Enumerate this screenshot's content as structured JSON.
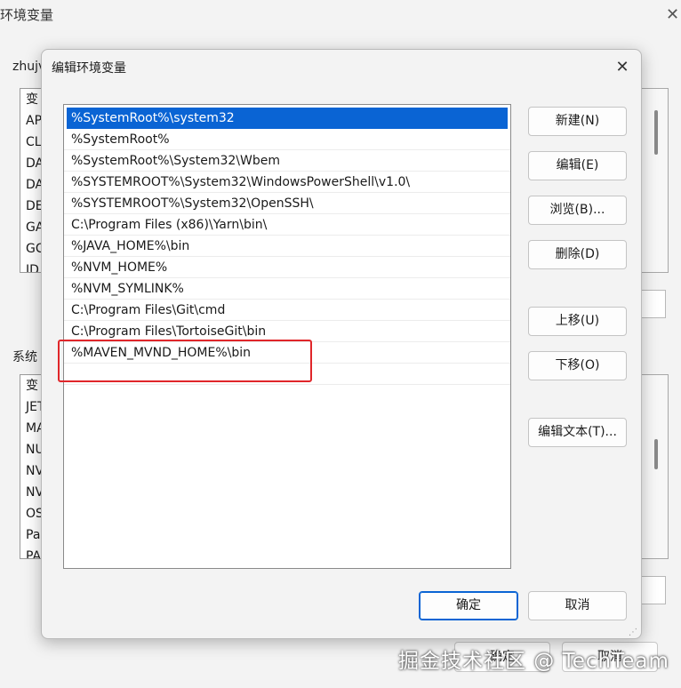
{
  "background": {
    "title": "环境变量",
    "close_glyph": "✕",
    "user_section_label": "zhujv",
    "user_vars": [
      "变",
      "AP",
      "CL",
      "DA",
      "DA",
      "DE",
      "GA",
      "GC",
      "ID"
    ],
    "system_section_label": "系统",
    "system_vars": [
      "变",
      "JET",
      "MA",
      "NU",
      "NV",
      "NV",
      "OS",
      "Pa",
      "PA"
    ],
    "ok_label": "确定",
    "cancel_label": "取消"
  },
  "dialog": {
    "title": "编辑环境变量",
    "close_glyph": "✕",
    "paths": [
      "%SystemRoot%\\system32",
      "%SystemRoot%",
      "%SystemRoot%\\System32\\Wbem",
      "%SYSTEMROOT%\\System32\\WindowsPowerShell\\v1.0\\",
      "%SYSTEMROOT%\\System32\\OpenSSH\\",
      "C:\\Program Files (x86)\\Yarn\\bin\\",
      "%JAVA_HOME%\\bin",
      "%NVM_HOME%",
      "%NVM_SYMLINK%",
      "C:\\Program Files\\Git\\cmd",
      "C:\\Program Files\\TortoiseGit\\bin",
      "%MAVEN_MVND_HOME%\\bin"
    ],
    "buttons": {
      "new": "新建(N)",
      "edit": "编辑(E)",
      "browse": "浏览(B)...",
      "delete": "删除(D)",
      "move_up": "上移(U)",
      "move_down": "下移(O)",
      "edit_text": "编辑文本(T)..."
    },
    "ok_label": "确定",
    "cancel_label": "取消",
    "grip": "⋰"
  },
  "watermark": "掘金技术社区 @ TechTeam",
  "colors": {
    "selection": "#0a64d4",
    "highlight_box": "#e0262a",
    "dialog_bg": "#f3f3f3"
  }
}
